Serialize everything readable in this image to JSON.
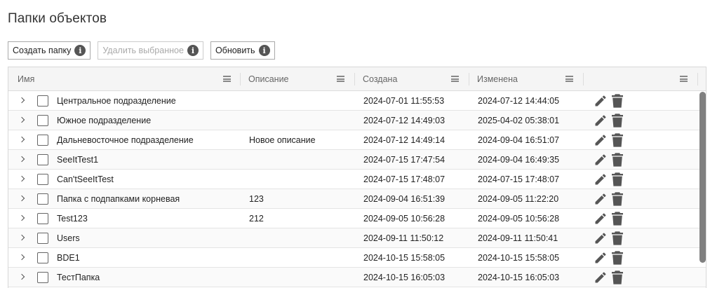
{
  "page": {
    "title": "Папки объектов"
  },
  "toolbar": {
    "create_label": "Создать папку",
    "delete_label": "Удалить выбранное",
    "refresh_label": "Обновить",
    "info_glyph": "i"
  },
  "table": {
    "columns": [
      "Имя",
      "Описание",
      "Создана",
      "Изменена",
      ""
    ],
    "rows": [
      {
        "name": "Центральное подразделение",
        "description": "",
        "created": "2024-07-01 11:55:53",
        "modified": "2024-07-12 14:44:05"
      },
      {
        "name": "Южное подразделение",
        "description": "",
        "created": "2024-07-12 14:49:03",
        "modified": "2025-04-02 05:38:01"
      },
      {
        "name": "Дальневосточное подразделение",
        "description": "Новое описание",
        "created": "2024-07-12 14:49:14",
        "modified": "2024-09-04 16:51:07"
      },
      {
        "name": "SeeItTest1",
        "description": "",
        "created": "2024-07-15 17:47:54",
        "modified": "2024-09-04 16:49:35"
      },
      {
        "name": "Can'tSeeItTest",
        "description": "",
        "created": "2024-07-15 17:48:07",
        "modified": "2024-07-15 17:48:07"
      },
      {
        "name": "Папка с подпапками корневая",
        "description": "123",
        "created": "2024-09-04 16:51:39",
        "modified": "2024-09-05 11:22:20"
      },
      {
        "name": "Test123",
        "description": "212",
        "created": "2024-09-05 10:56:28",
        "modified": "2024-09-05 10:56:28"
      },
      {
        "name": "Users",
        "description": "",
        "created": "2024-09-11 11:50:12",
        "modified": "2024-09-11 11:50:41"
      },
      {
        "name": "BDE1",
        "description": "",
        "created": "2024-10-15 15:58:05",
        "modified": "2024-10-15 15:58:05"
      },
      {
        "name": "ТестПапка",
        "description": "",
        "created": "2024-10-15 16:05:03",
        "modified": "2024-10-15 16:05:03"
      }
    ]
  },
  "icons": {
    "row_actions": [
      "pencil-icon",
      "trash-icon"
    ],
    "color": "#555555"
  }
}
